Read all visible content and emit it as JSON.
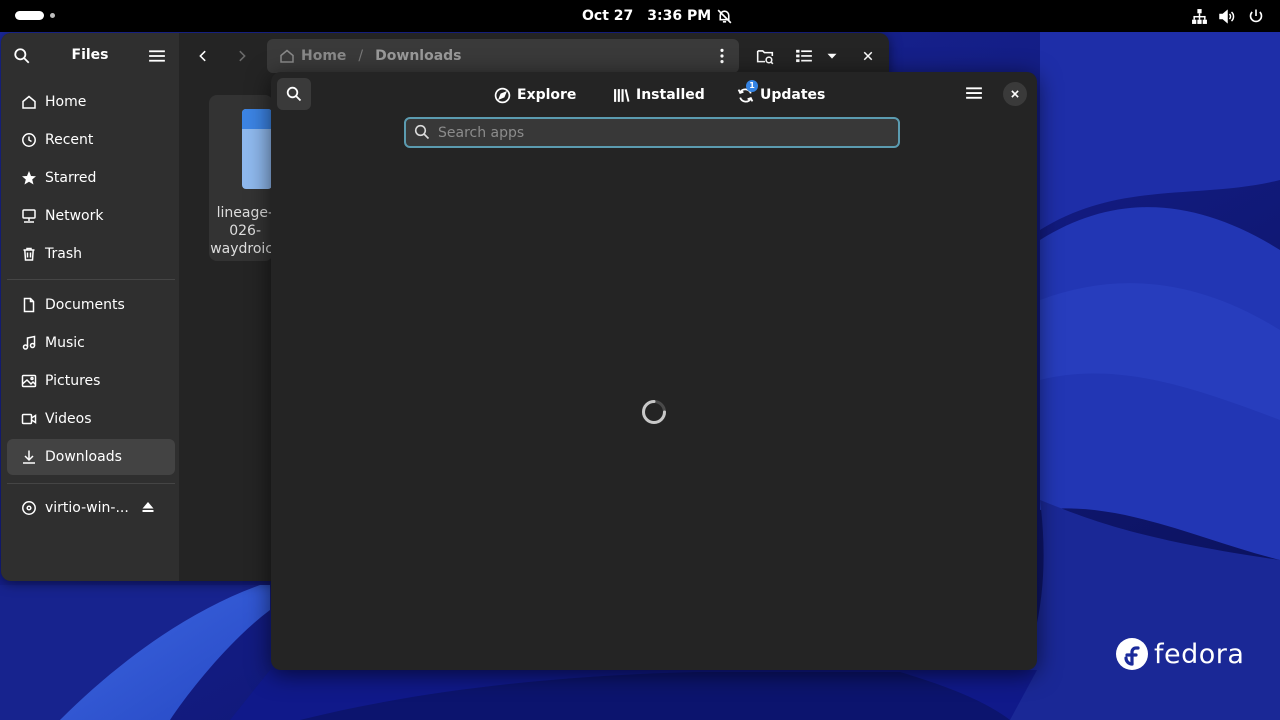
{
  "topbar": {
    "date": "Oct 27",
    "time": "3:36 PM",
    "icons": [
      "notifications-off-icon",
      "network-wired-icon",
      "volume-icon",
      "power-icon"
    ]
  },
  "files": {
    "title": "Files",
    "sidebar": {
      "places": [
        {
          "label": "Home",
          "icon": "home-icon"
        },
        {
          "label": "Recent",
          "icon": "clock-icon"
        },
        {
          "label": "Starred",
          "icon": "star-icon"
        },
        {
          "label": "Network",
          "icon": "network-icon"
        },
        {
          "label": "Trash",
          "icon": "trash-icon"
        }
      ],
      "bookmarks": [
        {
          "label": "Documents",
          "icon": "documents-icon"
        },
        {
          "label": "Music",
          "icon": "music-icon"
        },
        {
          "label": "Pictures",
          "icon": "pictures-icon"
        },
        {
          "label": "Videos",
          "icon": "videos-icon"
        },
        {
          "label": "Downloads",
          "icon": "download-icon",
          "active": true
        }
      ],
      "devices": [
        {
          "label": "virtio-win-...",
          "icon": "disc-icon"
        }
      ]
    },
    "path": {
      "home": "Home",
      "separator": "/",
      "current": "Downloads"
    },
    "file": {
      "name_lines": [
        "lineage-",
        "026-",
        "waydroic"
      ]
    }
  },
  "software": {
    "tabs": [
      {
        "label": "Explore",
        "icon": "compass-icon"
      },
      {
        "label": "Installed",
        "icon": "library-icon"
      },
      {
        "label": "Updates",
        "icon": "refresh-icon",
        "badge": "1"
      }
    ],
    "search": {
      "placeholder": "Search apps",
      "value": ""
    },
    "accent": "#3584e4"
  },
  "branding": {
    "logo_text": "fedora"
  }
}
